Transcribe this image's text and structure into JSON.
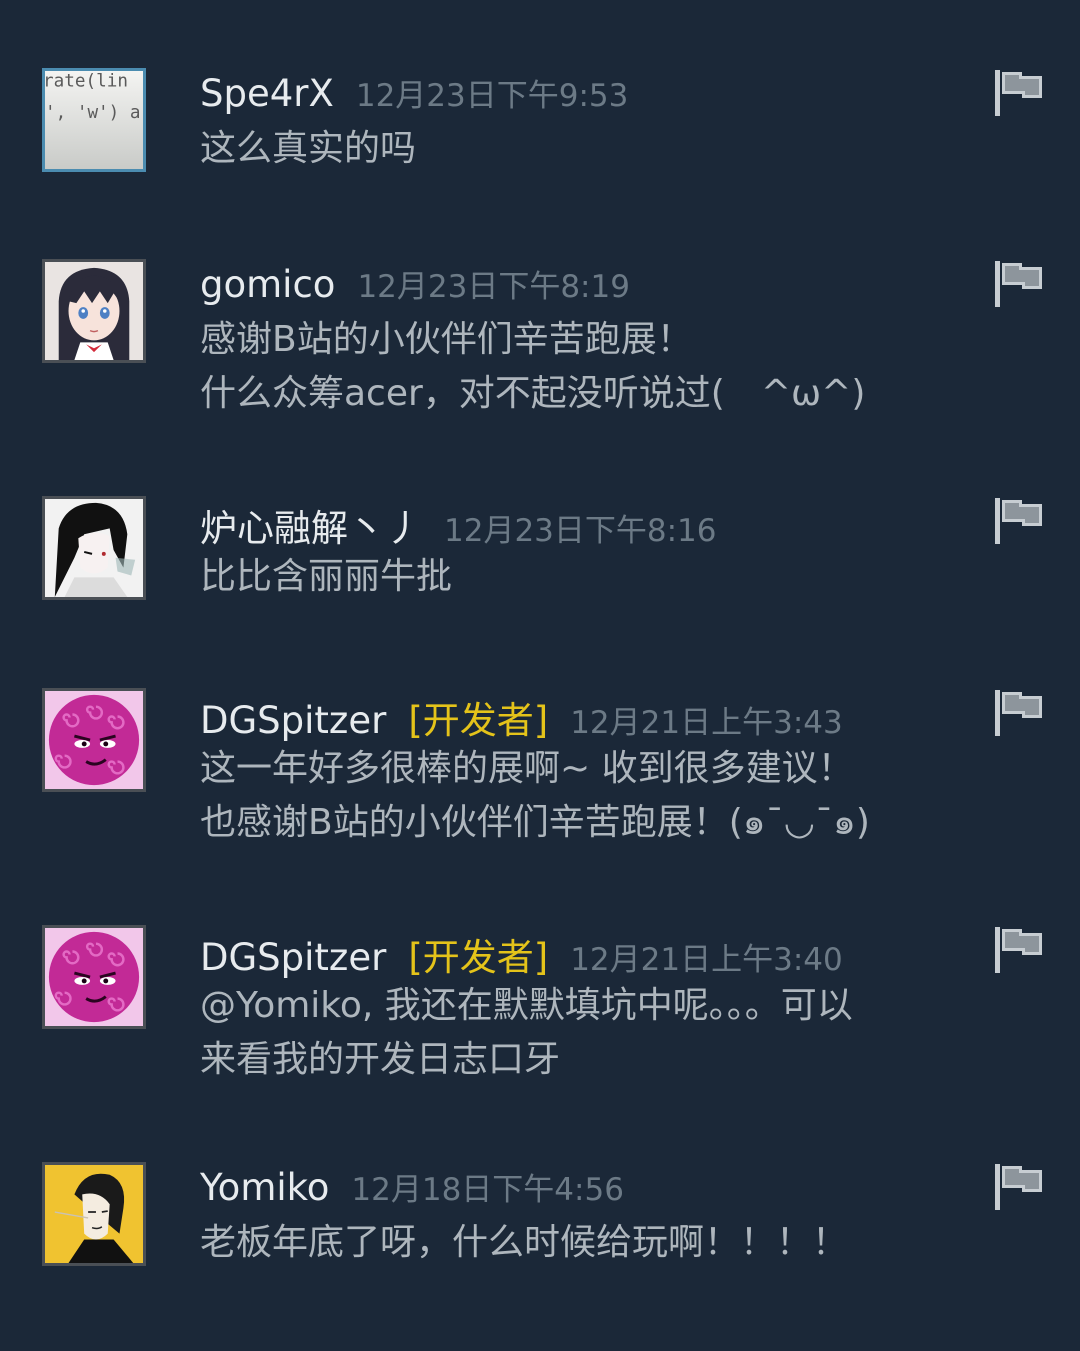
{
  "comments": [
    {
      "name": "Spe4rX",
      "badge": "",
      "time": "12月23日下午9:53",
      "text": "这么真实的吗",
      "avatar_icon": "code-screenshot-avatar",
      "report_icon": "flag-icon"
    },
    {
      "name": "gomico",
      "badge": "",
      "time": "12月23日下午8:19",
      "text": "感谢B站的小伙伴们辛苦跑展！\n什么众筹acer，对不起没听说过(　^ω^)",
      "avatar_icon": "anime-girl-avatar",
      "report_icon": "flag-icon"
    },
    {
      "name": "炉心融解丶丿",
      "badge": "",
      "time": "12月23日下午8:16",
      "text": "比比含丽丽牛批",
      "avatar_icon": "monochrome-character-avatar",
      "report_icon": "flag-icon"
    },
    {
      "name": "DGSpitzer",
      "badge": "[开发者]",
      "time": "12月21日上午3:43",
      "text": "这一年好多很棒的展啊~ 收到很多建议！\n也感谢B站的小伙伴们辛苦跑展！(๑¯◡¯๑)",
      "avatar_icon": "pink-swirl-face-avatar",
      "report_icon": "flag-icon"
    },
    {
      "name": "DGSpitzer",
      "badge": "[开发者]",
      "time": "12月21日上午3:40",
      "text": "@Yomiko, 我还在默默填坑中呢。。。可以\n来看我的开发日志口牙",
      "avatar_icon": "pink-swirl-face-avatar",
      "report_icon": "flag-icon"
    },
    {
      "name": "Yomiko",
      "badge": "",
      "time": "12月18日下午4:56",
      "text": "老板年底了呀，什么时候给玩啊！！！！",
      "avatar_icon": "ink-portrait-avatar",
      "report_icon": "flag-icon"
    }
  ],
  "colors": {
    "background": "#1b2838",
    "name": "#e7ebee",
    "badge": "#e4c31a",
    "timestamp": "#6c7a86",
    "text": "#aeb6bd"
  }
}
